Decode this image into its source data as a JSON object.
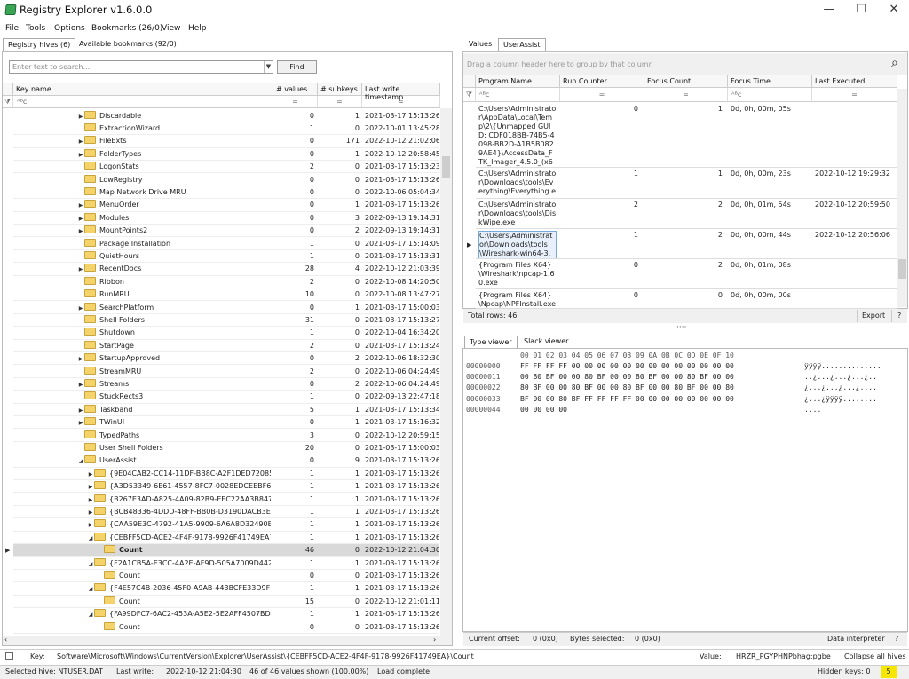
{
  "app": {
    "title": "Registry Explorer v1.6.0.0"
  },
  "window_controls": [
    "—",
    "☐",
    "✕"
  ],
  "menu": [
    "File",
    "Tools",
    "Options",
    "Bookmarks (26/0)",
    "View",
    "Help"
  ],
  "left_tabs": [
    "Registry hives (6)",
    "Available bookmarks (92/0)"
  ],
  "search": {
    "placeholder": "Enter text to search...",
    "find_label": "Find"
  },
  "tree": {
    "headers": [
      "Key name",
      "# values",
      "# subkeys",
      "Last write timestamp"
    ],
    "filter_glyph": "ᴬᴮc",
    "filter_eq": "=",
    "rows": [
      {
        "name": "Discardable",
        "indent": 0,
        "exp": "▶",
        "values": "0",
        "subkeys": "1",
        "ts": "2021-03-17 15:13:26"
      },
      {
        "name": "ExtractionWizard",
        "indent": 0,
        "exp": "",
        "values": "1",
        "subkeys": "0",
        "ts": "2022-10-01 13:45:28"
      },
      {
        "name": "FileExts",
        "indent": 0,
        "exp": "▶",
        "values": "0",
        "subkeys": "171",
        "ts": "2022-10-12 21:02:06"
      },
      {
        "name": "FolderTypes",
        "indent": 0,
        "exp": "▶",
        "values": "0",
        "subkeys": "1",
        "ts": "2022-10-12 20:58:45"
      },
      {
        "name": "LogonStats",
        "indent": 0,
        "exp": "",
        "values": "2",
        "subkeys": "0",
        "ts": "2021-03-17 15:13:23"
      },
      {
        "name": "LowRegistry",
        "indent": 0,
        "exp": "",
        "values": "0",
        "subkeys": "0",
        "ts": "2021-03-17 15:13:26"
      },
      {
        "name": "Map Network Drive MRU",
        "indent": 0,
        "exp": "",
        "values": "0",
        "subkeys": "0",
        "ts": "2022-10-06 05:04:34"
      },
      {
        "name": "MenuOrder",
        "indent": 0,
        "exp": "▶",
        "values": "0",
        "subkeys": "1",
        "ts": "2021-03-17 15:13:26"
      },
      {
        "name": "Modules",
        "indent": 0,
        "exp": "▶",
        "values": "0",
        "subkeys": "3",
        "ts": "2022-09-13 19:14:31"
      },
      {
        "name": "MountPoints2",
        "indent": 0,
        "exp": "▶",
        "values": "0",
        "subkeys": "2",
        "ts": "2022-09-13 19:14:31"
      },
      {
        "name": "Package Installation",
        "indent": 0,
        "exp": "",
        "values": "1",
        "subkeys": "0",
        "ts": "2021-03-17 15:14:09"
      },
      {
        "name": "QuietHours",
        "indent": 0,
        "exp": "",
        "values": "1",
        "subkeys": "0",
        "ts": "2021-03-17 15:13:31"
      },
      {
        "name": "RecentDocs",
        "indent": 0,
        "exp": "▶",
        "values": "28",
        "subkeys": "4",
        "ts": "2022-10-12 21:03:39"
      },
      {
        "name": "Ribbon",
        "indent": 0,
        "exp": "",
        "values": "2",
        "subkeys": "0",
        "ts": "2022-10-08 14:20:50"
      },
      {
        "name": "RunMRU",
        "indent": 0,
        "exp": "",
        "values": "10",
        "subkeys": "0",
        "ts": "2022-10-08 13:47:27"
      },
      {
        "name": "SearchPlatform",
        "indent": 0,
        "exp": "▶",
        "values": "0",
        "subkeys": "1",
        "ts": "2021-03-17 15:00:03"
      },
      {
        "name": "Shell Folders",
        "indent": 0,
        "exp": "",
        "values": "31",
        "subkeys": "0",
        "ts": "2021-03-17 15:13:27"
      },
      {
        "name": "Shutdown",
        "indent": 0,
        "exp": "",
        "values": "1",
        "subkeys": "0",
        "ts": "2022-10-04 16:34:20"
      },
      {
        "name": "StartPage",
        "indent": 0,
        "exp": "",
        "values": "2",
        "subkeys": "0",
        "ts": "2021-03-17 15:13:24"
      },
      {
        "name": "StartupApproved",
        "indent": 0,
        "exp": "▶",
        "values": "0",
        "subkeys": "2",
        "ts": "2022-10-06 18:32:30"
      },
      {
        "name": "StreamMRU",
        "indent": 0,
        "exp": "",
        "values": "2",
        "subkeys": "0",
        "ts": "2022-10-06 04:24:49"
      },
      {
        "name": "Streams",
        "indent": 0,
        "exp": "▶",
        "values": "0",
        "subkeys": "2",
        "ts": "2022-10-06 04:24:49"
      },
      {
        "name": "StuckRects3",
        "indent": 0,
        "exp": "",
        "values": "1",
        "subkeys": "0",
        "ts": "2022-09-13 22:47:18"
      },
      {
        "name": "Taskband",
        "indent": 0,
        "exp": "▶",
        "values": "5",
        "subkeys": "1",
        "ts": "2021-03-17 15:13:34"
      },
      {
        "name": "TWinUI",
        "indent": 0,
        "exp": "▶",
        "values": "0",
        "subkeys": "1",
        "ts": "2021-03-17 15:16:32"
      },
      {
        "name": "TypedPaths",
        "indent": 0,
        "exp": "",
        "values": "3",
        "subkeys": "0",
        "ts": "2022-10-12 20:59:15"
      },
      {
        "name": "User Shell Folders",
        "indent": 0,
        "exp": "",
        "values": "20",
        "subkeys": "0",
        "ts": "2021-03-17 15:00:03"
      },
      {
        "name": "UserAssist",
        "indent": 0,
        "exp": "◢",
        "values": "0",
        "subkeys": "9",
        "ts": "2021-03-17 15:13:26"
      },
      {
        "name": "{9E04CAB2-CC14-11DF-BB8C-A2F1DED72085}",
        "indent": 1,
        "exp": "▶",
        "values": "1",
        "subkeys": "1",
        "ts": "2021-03-17 15:13:26"
      },
      {
        "name": "{A3D53349-6E61-4557-8FC7-0028EDCEEBF6}",
        "indent": 1,
        "exp": "▶",
        "values": "1",
        "subkeys": "1",
        "ts": "2021-03-17 15:13:26"
      },
      {
        "name": "{B267E3AD-A825-4A09-82B9-EEC22AA3B847}",
        "indent": 1,
        "exp": "▶",
        "values": "1",
        "subkeys": "1",
        "ts": "2021-03-17 15:13:26"
      },
      {
        "name": "{BCB48336-4DDD-48FF-BB0B-D3190DACB3E2}",
        "indent": 1,
        "exp": "▶",
        "values": "1",
        "subkeys": "1",
        "ts": "2021-03-17 15:13:26"
      },
      {
        "name": "{CAA59E3C-4792-41A5-9909-6A6A8D32490E}",
        "indent": 1,
        "exp": "▶",
        "values": "1",
        "subkeys": "1",
        "ts": "2021-03-17 15:13:26"
      },
      {
        "name": "{CEBFF5CD-ACE2-4F4F-9178-9926F41749EA}",
        "indent": 1,
        "exp": "◢",
        "values": "1",
        "subkeys": "1",
        "ts": "2021-03-17 15:13:26"
      },
      {
        "name": "Count",
        "indent": 2,
        "exp": "",
        "values": "46",
        "subkeys": "0",
        "ts": "2022-10-12 21:04:30",
        "selected": true
      },
      {
        "name": "{F2A1CB5A-E3CC-4A2E-AF9D-505A7009D442}",
        "indent": 1,
        "exp": "◢",
        "values": "1",
        "subkeys": "1",
        "ts": "2021-03-17 15:13:26"
      },
      {
        "name": "Count",
        "indent": 2,
        "exp": "",
        "values": "0",
        "subkeys": "0",
        "ts": "2021-03-17 15:13:26"
      },
      {
        "name": "{F4E57C4B-2036-45F0-A9AB-443BCFE33D9F}",
        "indent": 1,
        "exp": "◢",
        "values": "1",
        "subkeys": "1",
        "ts": "2021-03-17 15:13:26"
      },
      {
        "name": "Count",
        "indent": 2,
        "exp": "",
        "values": "15",
        "subkeys": "0",
        "ts": "2022-10-12 21:01:11"
      },
      {
        "name": "{FA99DFC7-6AC2-453A-A5E2-5E2AFF4507BD}",
        "indent": 1,
        "exp": "◢",
        "values": "1",
        "subkeys": "1",
        "ts": "2021-03-17 15:13:26"
      },
      {
        "name": "Count",
        "indent": 2,
        "exp": "",
        "values": "0",
        "subkeys": "0",
        "ts": "2021-03-17 15:13:26"
      }
    ]
  },
  "right_tabs": [
    "Values",
    "UserAssist"
  ],
  "userassist": {
    "group_hint": "Drag a column header here to group by that column",
    "headers": [
      "Program Name",
      "Run Counter",
      "Focus Count",
      "Focus Time",
      "Last Executed"
    ],
    "rows": [
      {
        "name": "C:\\Users\\Administrator\\AppData\\Local\\Temp\\2\\{Unmapped GUID: CDF018BB-74B5-4098-BB2D-A1B5B0829AE4}\\AccessData_FTK_Imager_4.5.0_(x64).exe",
        "run": "0",
        "focus": "1",
        "time": "0d, 0h, 00m, 05s",
        "last": ""
      },
      {
        "name": "C:\\Users\\Administrator\\Downloads\\tools\\Everything\\Everything.exe",
        "run": "1",
        "focus": "1",
        "time": "0d, 0h, 00m, 23s",
        "last": "2022-10-12 19:29:32"
      },
      {
        "name": "C:\\Users\\Administrator\\Downloads\\tools\\DiskWipe.exe",
        "run": "2",
        "focus": "2",
        "time": "0d, 0h, 01m, 54s",
        "last": "2022-10-12 20:59:50"
      },
      {
        "name": "C:\\Users\\Administrator\\Downloads\\tools\\Wireshark-win64-3.6.8.exe",
        "run": "1",
        "focus": "2",
        "time": "0d, 0h, 00m, 44s",
        "last": "2022-10-12 20:56:06",
        "current": true
      },
      {
        "name": "{Program Files X64}\\Wireshark\\npcap-1.60.exe",
        "run": "0",
        "focus": "2",
        "time": "0d, 0h, 01m, 08s",
        "last": ""
      },
      {
        "name": "{Program Files X64}\\Npcap\\NPFInstall.exe",
        "run": "0",
        "focus": "0",
        "time": "0d, 0h, 00m, 00s",
        "last": ""
      }
    ],
    "total": "Total rows: 46",
    "export": "Export",
    "help": "?"
  },
  "viewer_tabs": [
    "Type viewer",
    "Slack viewer"
  ],
  "hex": {
    "header": "00 01 02 03 04 05 06 07 08 09 0A 0B 0C 0D 0E 0F 10",
    "lines": [
      {
        "off": "00000000",
        "bytes": "FF FF FF FF 00 00 00 00 00 00 00 00 00 00 00 00 00",
        "ascii": "ÿÿÿÿ.............."
      },
      {
        "off": "00000011",
        "bytes": "00 80 BF 00 00 80 BF 00 00 80 BF 00 00 80 BF 00 00",
        "ascii": "..¿...¿...¿...¿.."
      },
      {
        "off": "00000022",
        "bytes": "80 BF 00 00 80 BF 00 00 80 BF 00 00 80 BF 00 00 80",
        "ascii": "¿...¿...¿...¿...."
      },
      {
        "off": "00000033",
        "bytes": "BF 00 00 80 BF FF FF FF FF 00 00 00 00 00 00 00 00",
        "ascii": "¿...¿ÿÿÿÿ........"
      },
      {
        "off": "00000044",
        "bytes": "00 00 00 00",
        "ascii": "...."
      }
    ],
    "offset_label": "Current offset:",
    "offset_value": "0 (0x0)",
    "bytes_label": "Bytes selected:",
    "bytes_value": "0 (0x0)",
    "interpreter": "Data interpreter",
    "help": "?"
  },
  "status": {
    "key_label": "Key:",
    "key_value": "Software\\Microsoft\\Windows\\CurrentVersion\\Explorer\\UserAssist\\{CEBFF5CD-ACE2-4F4F-9178-9926F41749EA}\\Count",
    "value_label": "Value:",
    "value_value": "HRZR_PGYPHNPbhag:pgbe",
    "collapse": "Collapse all hives",
    "hive": "Selected hive: NTUSER.DAT",
    "lastwrite_label": "Last write:",
    "lastwrite_value": "2022-10-12 21:04:30",
    "shown": "46 of 46 values shown (100.00%)",
    "load": "Load complete",
    "hidden_label": "Hidden keys: 0",
    "hidden_badge": "5"
  }
}
